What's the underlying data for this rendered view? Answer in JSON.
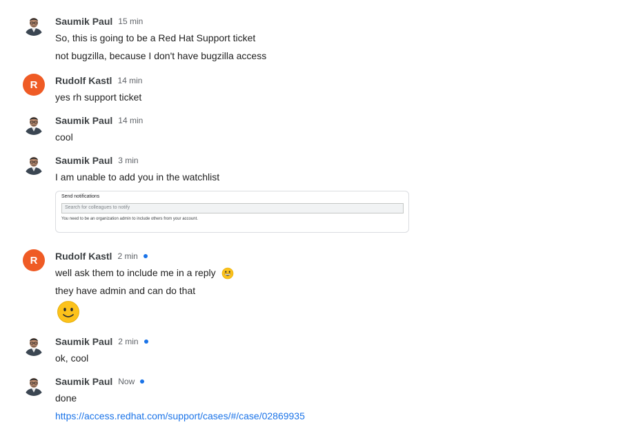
{
  "colors": {
    "link": "#1a73e8",
    "unread_dot": "#1a73e8",
    "avatar_letter_bg": "#ef5b25"
  },
  "messages": [
    {
      "author": "Saumik Paul",
      "time": "15 min",
      "avatar": "person-photo",
      "lines": [
        "So, this is going to be a Red Hat Support ticket",
        "not bugzilla, because I don't have bugzilla access"
      ]
    },
    {
      "author": "Rudolf Kastl",
      "time": "14 min",
      "avatar_letter": "R",
      "lines": [
        "yes rh support ticket"
      ]
    },
    {
      "author": "Saumik Paul",
      "time": "14 min",
      "avatar": "person-photo",
      "lines": [
        "cool"
      ]
    },
    {
      "author": "Saumik Paul",
      "time": "3 min",
      "avatar": "person-photo",
      "lines": [
        "I am unable to add you in the watchlist"
      ],
      "attachment": {
        "title": "Send notifications",
        "placeholder": "Search for colleagues to notify",
        "note": "You need to be an organization admin to include others from your account."
      }
    },
    {
      "author": "Rudolf Kastl",
      "time": "2 min",
      "avatar_letter": "R",
      "unread": true,
      "lines": [
        "well ask them to include me in a reply",
        "they have admin and can do that"
      ],
      "emojis": [
        "grinning-face-emoji",
        "slightly-smiling-face-emoji"
      ]
    },
    {
      "author": "Saumik Paul",
      "time": "2 min",
      "avatar": "person-photo",
      "unread": true,
      "lines": [
        "ok, cool"
      ]
    },
    {
      "author": "Saumik Paul",
      "time": "Now",
      "avatar": "person-photo",
      "unread": true,
      "lines": [
        "done"
      ],
      "link": "https://access.redhat.com/support/cases/#/case/02869935"
    }
  ]
}
